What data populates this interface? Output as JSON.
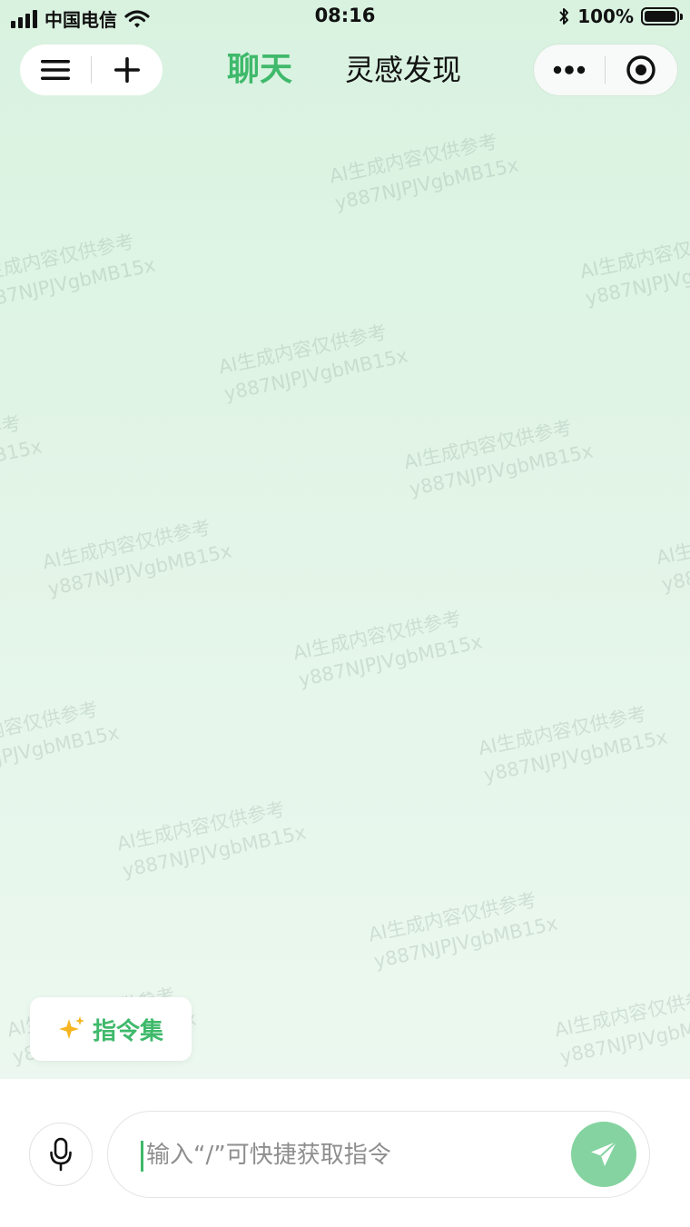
{
  "status_bar": {
    "carrier": "中国电信",
    "time": "08:16",
    "battery": "100%",
    "battery_level": 1.0
  },
  "nav": {
    "tabs": [
      {
        "label": "聊天",
        "active": true
      },
      {
        "label": "灵感发现",
        "active": false
      }
    ],
    "icons": {
      "left": [
        "menu-icon",
        "plus-icon"
      ],
      "right": [
        "more-icon",
        "target-icon"
      ]
    }
  },
  "watermark": {
    "line1": "AI生成内容仅供参考",
    "line2": "y887NJPJVgbMB15x"
  },
  "command_chip": {
    "label": "指令集",
    "icon": "sparkle-icon"
  },
  "input": {
    "placeholder": "输入“/”可快捷获取指令",
    "value": ""
  },
  "colors": {
    "accent": "#3fb96b",
    "send_button": "#84d3a0",
    "sparkle": "#f5b622"
  }
}
